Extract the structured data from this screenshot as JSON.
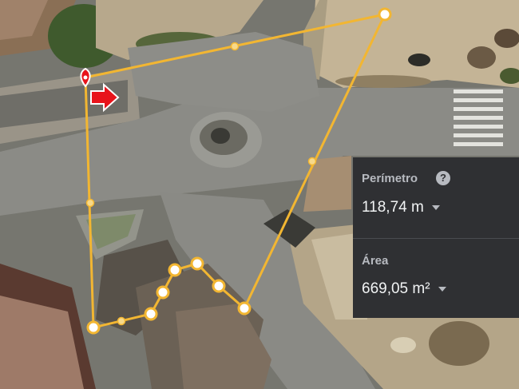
{
  "measurement": {
    "perimeter_label": "Perímetro",
    "perimeter_value": "118,74 m",
    "area_label": "Área",
    "area_value": "669,05 m²",
    "help_glyph": "?"
  },
  "colors": {
    "measure_line": "#f2b632",
    "vertex_fill": "#ffffff",
    "start_marker": "#e8141b",
    "arrow": "#e8141b",
    "panel_bg": "#2f3033"
  },
  "icons": [
    "help-icon",
    "dropdown-caret-icon",
    "start-point-marker-icon",
    "arrow-right-icon"
  ]
}
